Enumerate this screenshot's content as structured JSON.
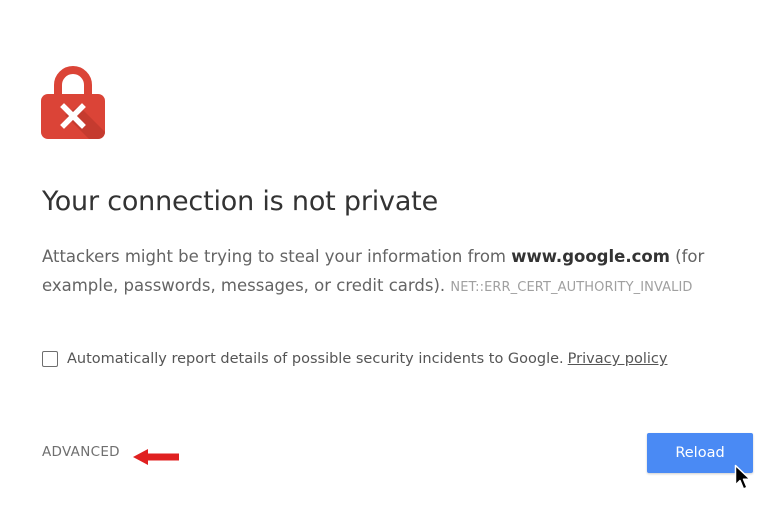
{
  "interstitial": {
    "icon": "lock-error-icon",
    "title": "Your connection is not private",
    "message_before_host": "Attackers might be trying to steal your information from ",
    "host": "www.google.com",
    "message_after_host": " (for example, passwords, messages, or credit cards). ",
    "error_code": "NET::ERR_CERT_AUTHORITY_INVALID"
  },
  "report": {
    "checked": false,
    "label": "Automatically report details of possible security incidents to Google.",
    "privacy_link": "Privacy policy"
  },
  "actions": {
    "advanced_label": "ADVANCED",
    "reload_label": "Reload"
  },
  "annotation": {
    "icon": "red-arrow-icon",
    "color": "#e02020"
  },
  "colors": {
    "lock": "#db4437",
    "lock_shadow": "#b3342a",
    "primary_button": "#4a8af4"
  },
  "cursor": "mouse-pointer-icon"
}
